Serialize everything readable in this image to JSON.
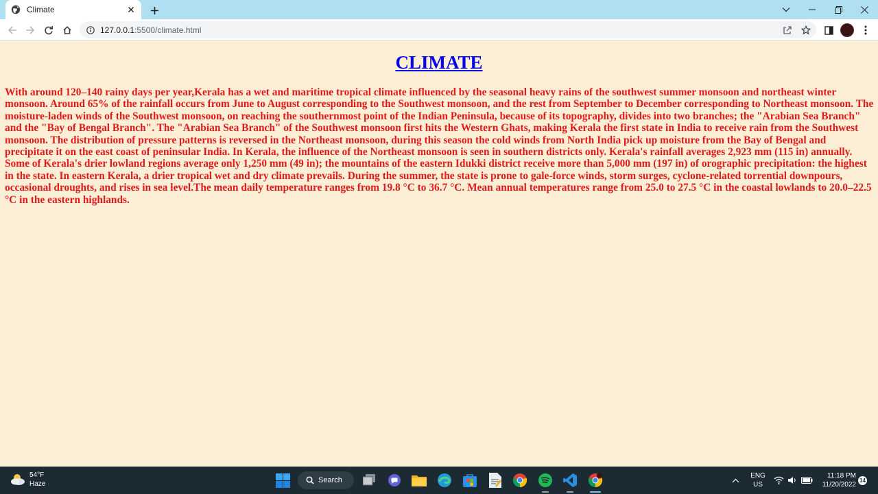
{
  "browser": {
    "tab_title": "Climate",
    "url_host": "127.0.0.1",
    "url_path": ":5500/climate.html"
  },
  "page": {
    "title": "CLIMATE",
    "paragraph": "With around 120–140 rainy days per year,Kerala has a wet and maritime tropical climate influenced by the seasonal heavy rains of the southwest summer monsoon and northeast winter monsoon. Around 65% of the rainfall occurs from June to August corresponding to the Southwest monsoon, and the rest from September to December corresponding to Northeast monsoon. The moisture-laden winds of the Southwest monsoon, on reaching the southernmost point of the Indian Peninsula, because of its topography, divides into two branches; the \"Arabian Sea Branch\" and the \"Bay of Bengal Branch\". The \"Arabian Sea Branch\" of the Southwest monsoon first hits the Western Ghats, making Kerala the first state in India to receive rain from the Southwest monsoon. The distribution of pressure patterns is reversed in the Northeast monsoon, during this season the cold winds from North India pick up moisture from the Bay of Bengal and precipitate it on the east coast of peninsular India. In Kerala, the influence of the Northeast monsoon is seen in southern districts only. Kerala's rainfall averages 2,923 mm (115 in) annually. Some of Kerala's drier lowland regions average only 1,250 mm (49 in); the mountains of the eastern Idukki district receive more than 5,000 mm (197 in) of orographic precipitation: the highest in the state. In eastern Kerala, a drier tropical wet and dry climate prevails. During the summer, the state is prone to gale-force winds, storm surges, cyclone-related torrential downpours, occasional droughts, and rises in sea level.The mean daily temperature ranges from 19.8 °C to 36.7 °C. Mean annual temperatures range from 25.0 to 27.5 °C in the coastal lowlands to 20.0–22.5 °C in the eastern highlands."
  },
  "taskbar": {
    "weather_temp": "54°F",
    "weather_condition": "Haze",
    "search_label": "Search",
    "lang_top": "ENG",
    "lang_bottom": "US",
    "time": "11:18 PM",
    "date": "11/20/2022",
    "notification_count": "14"
  },
  "colors": {
    "page_background": "#fdeed6",
    "title_color": "#0000ee",
    "text_color": "#e01b1b",
    "tabstrip": "#aee0f2",
    "taskbar": "#1b2a33"
  },
  "icons": {
    "tab_favicon": "globe-icon",
    "tab_close": "close-icon",
    "new_tab": "plus-icon",
    "back": "back-arrow-icon",
    "forward": "forward-arrow-icon",
    "reload": "reload-icon",
    "home": "home-icon",
    "site_info": "info-icon",
    "share": "share-icon",
    "bookmark": "star-icon",
    "side_panel": "side-panel-icon",
    "menu": "kebab-menu-icon"
  }
}
